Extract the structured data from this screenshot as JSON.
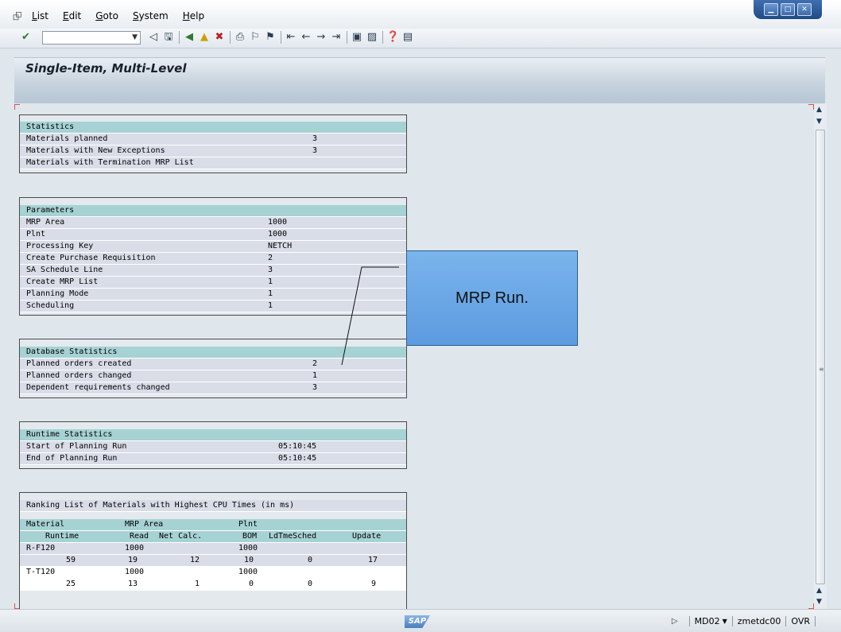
{
  "menu": {
    "items": [
      {
        "label": "List",
        "underline": "L",
        "rest": "ist"
      },
      {
        "label": "Edit",
        "underline": "E",
        "rest": "dit"
      },
      {
        "label": "Goto",
        "underline": "G",
        "rest": "oto"
      },
      {
        "label": "System",
        "underline": "S",
        "rest": "ystem"
      },
      {
        "label": "Help",
        "underline": "H",
        "rest": "elp"
      }
    ]
  },
  "toolbar": {
    "command_value": "",
    "icons": [
      "save-icon",
      "back-icon",
      "exit-icon",
      "cancel-icon",
      "print-icon",
      "find-icon",
      "find-next-icon",
      "first-page-icon",
      "previous-page-icon",
      "next-page-icon",
      "last-page-icon",
      "create-session-icon",
      "shortcut-icon",
      "help-icon",
      "customize-layout-icon"
    ]
  },
  "title": "Single-Item, Multi-Level",
  "statistics": {
    "header": "Statistics",
    "rows": [
      {
        "label": "Materials planned",
        "value": "3"
      },
      {
        "label": "Materials with New Exceptions",
        "value": "3"
      },
      {
        "label": "Materials with Termination MRP List",
        "value": ""
      }
    ]
  },
  "parameters": {
    "header": "Parameters",
    "rows": [
      {
        "label": "MRP Area",
        "value": "1000"
      },
      {
        "label": "Plnt",
        "value": "1000"
      },
      {
        "label": "Processing Key",
        "value": "NETCH"
      },
      {
        "label": "Create Purchase Requisition",
        "value": "2"
      },
      {
        "label": "SA Schedule Line",
        "value": "3"
      },
      {
        "label": "Create MRP List",
        "value": "1"
      },
      {
        "label": "Planning Mode",
        "value": "1"
      },
      {
        "label": "Scheduling",
        "value": "1"
      }
    ]
  },
  "database_statistics": {
    "header": "Database Statistics",
    "rows": [
      {
        "label": "Planned orders created",
        "value": "2"
      },
      {
        "label": "Planned orders changed",
        "value": "1"
      },
      {
        "label": "Dependent requirements changed",
        "value": "3"
      }
    ]
  },
  "runtime_statistics": {
    "header": "Runtime Statistics",
    "rows": [
      {
        "label": "Start of Planning Run",
        "value": "05:10:45"
      },
      {
        "label": "End of Planning Run",
        "value": "05:10:45"
      }
    ]
  },
  "ranking": {
    "header": "Ranking List of Materials with Highest CPU Times (in ms)",
    "col_header1": {
      "material": "Material",
      "mrp_area": "MRP Area",
      "plnt": "Plnt"
    },
    "col_header2": {
      "runtime": "Runtime",
      "read": "Read",
      "net_calc": "Net Calc.",
      "bom": "BOM",
      "ldtmesched": "LdTmeSched",
      "update": "Update"
    },
    "items": [
      {
        "material": "R-F120",
        "mrp_area": "1000",
        "plnt": "1000",
        "runtime": "59",
        "read": "19",
        "net_calc": "12",
        "bom": "10",
        "ldtmesched": "0",
        "update": "17"
      },
      {
        "material": "T-T120",
        "mrp_area": "1000",
        "plnt": "1000",
        "runtime": "25",
        "read": "13",
        "net_calc": "1",
        "bom": "0",
        "ldtmesched": "0",
        "update": "9"
      }
    ]
  },
  "callout": {
    "text": "MRP Run."
  },
  "status": {
    "sap_logo": "SAP",
    "transaction": "MD02",
    "server": "zmetdc00",
    "mode": "OVR"
  },
  "colors": {
    "header_row": "#a6d2d4",
    "data_row": "#d9dde8",
    "callout": "#6ea9e8"
  }
}
